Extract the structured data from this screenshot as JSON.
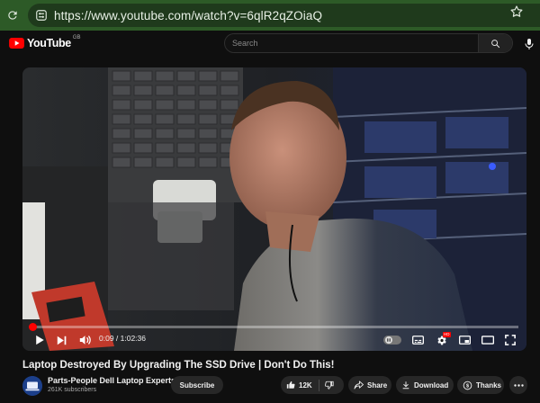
{
  "browser": {
    "url": "https://www.youtube.com/watch?v=6qlR2qZOiaQ",
    "icons": {
      "reload": "reload-icon",
      "site_info": "site-info-icon",
      "bookmark": "star-icon"
    }
  },
  "header": {
    "logo_text": "YouTube",
    "region": "GB",
    "search_placeholder": "Search"
  },
  "player": {
    "current_time": "0:09",
    "duration": "1:02:36",
    "time_display": "0:09 / 1:02:36",
    "progress_fraction": 0.0024,
    "hd_badge": "HD",
    "accent": "#ff0000"
  },
  "video": {
    "title": "Laptop Destroyed By Upgrading The SSD Drive | Don't Do This!",
    "channel_name": "Parts-People Dell Laptop Experts",
    "subscribers": "261K subscribers",
    "subscribe_label": "Subscribe",
    "like_count": "12K",
    "share_label": "Share",
    "download_label": "Download",
    "thanks_label": "Thanks"
  },
  "colors": {
    "browser_bar": "#2d5a27",
    "page_bg": "#0f0f0f",
    "pill_bg": "#272727",
    "youtube_red": "#ff0000"
  }
}
